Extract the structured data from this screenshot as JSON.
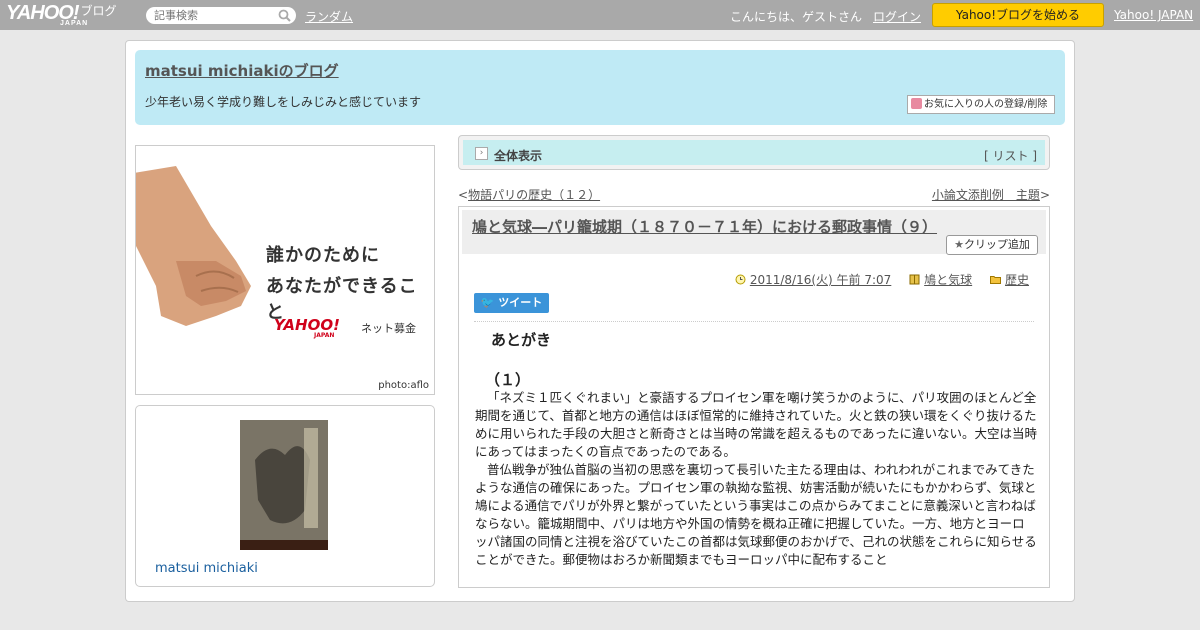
{
  "topbar": {
    "logo_text": "YAHOO!",
    "logo_sub": "ブログ",
    "logo_japan": "JAPAN",
    "search_placeholder": "記事検索",
    "random_label": "ランダム",
    "greeting": "こんにちは、ゲストさん",
    "login_label": "ログイン",
    "start_button": "Yahoo!ブログを始める",
    "yahoo_japan_link": "Yahoo! JAPAN"
  },
  "header": {
    "title": "matsui michiakiのブログ",
    "description": "少年老い易く学成り難しをしみじみと感じています",
    "favorite_button": "お気に入りの人の登録/削除"
  },
  "banner": {
    "line1": "誰かのために",
    "line2": "あなたができること",
    "brand": "YAHOO!",
    "brand_japan": "JAPAN",
    "brand_sub": "ネット募金",
    "credit": "photo:aflo"
  },
  "profile": {
    "name": "matsui michiaki"
  },
  "nav": {
    "all_label": "全体表示",
    "list_open": "[ ",
    "list_label": "リスト",
    "list_close": " ]"
  },
  "pager": {
    "prev_mark": "<",
    "prev_label": "物語パリの歴史（１２）",
    "next_label": "小論文添削例　主題",
    "next_mark": ">"
  },
  "article": {
    "title": "鳩と気球―パリ籠城期（１８７０－７１年）における郵政事情（９）",
    "clip_button": "クリップ追加",
    "date": "2011/8/16(火) 午前 7:07",
    "category1": "鳩と気球",
    "category2": "歴史",
    "tweet_label": "ツイート",
    "heading": "あとがき",
    "subheading": "（１）",
    "paragraphs": [
      "「ネズミ１匹くぐれまい」と豪語するプロイセン軍を嘲け笑うかのように、パリ攻囲のほとんど全期間を通じて、首都と地方の通信はほぼ恒常的に維持されていた。火と鉄の狭い環をくぐり抜けるために用いられた手段の大胆さと新奇さとは当時の常識を超えるものであったに違いない。大空は当時にあってはまったくの盲点であったのである。",
      "普仏戦争が独仏首脳の当初の思惑を裏切って長引いた主たる理由は、われわれがこれまでみてきたような通信の確保にあった。プロイセン軍の執拗な監視、妨害活動が続いたにもかかわらず、気球と鳩による通信でパリが外界と繋がっていたという事実はこの点からみてまことに意義深いと言わねばならない。籠城期間中、パリは地方や外国の情勢を概ね正確に把握していた。一方、地方とヨーロッパ諸国の同情と注視を浴びていたこの首都は気球郵便のおかげで、己れの状態をこれらに知らせることができた。郵便物はおろか新聞類までもヨーロッパ中に配布すること"
    ]
  }
}
